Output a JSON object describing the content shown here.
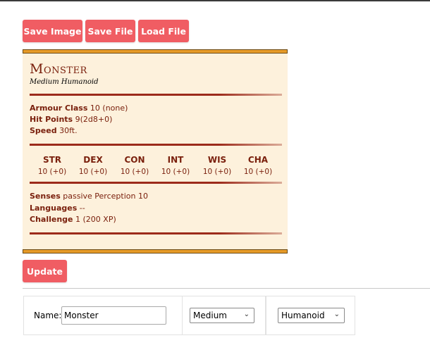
{
  "toolbar": {
    "save_image": "Save Image",
    "save_file": "Save File",
    "load_file": "Load File"
  },
  "monster": {
    "name": "Monster",
    "type_line": "Medium Humanoid",
    "armour_class_label": "Armour Class",
    "armour_class_value": "10 (none)",
    "hit_points_label": "Hit Points",
    "hit_points_value": "9(2d8+0)",
    "speed_label": "Speed",
    "speed_value": "30ft.",
    "abilities": [
      {
        "name": "STR",
        "score": "10 (+0)"
      },
      {
        "name": "DEX",
        "score": "10 (+0)"
      },
      {
        "name": "CON",
        "score": "10 (+0)"
      },
      {
        "name": "INT",
        "score": "10 (+0)"
      },
      {
        "name": "WIS",
        "score": "10 (+0)"
      },
      {
        "name": "CHA",
        "score": "10 (+0)"
      }
    ],
    "senses_label": "Senses",
    "senses_value": "passive Perception 10",
    "languages_label": "Languages",
    "languages_value": "--",
    "challenge_label": "Challenge",
    "challenge_value": "1 (200 XP)"
  },
  "update_button": "Update",
  "form": {
    "name_label": "Name:",
    "name_value": "Monster",
    "size_selected": "Medium",
    "type_selected": "Humanoid"
  },
  "colors": {
    "button": "#f05d63",
    "statblock_bg": "#fdf1dc",
    "statblock_text": "#7a200d",
    "border_gold": "#e69a28"
  }
}
